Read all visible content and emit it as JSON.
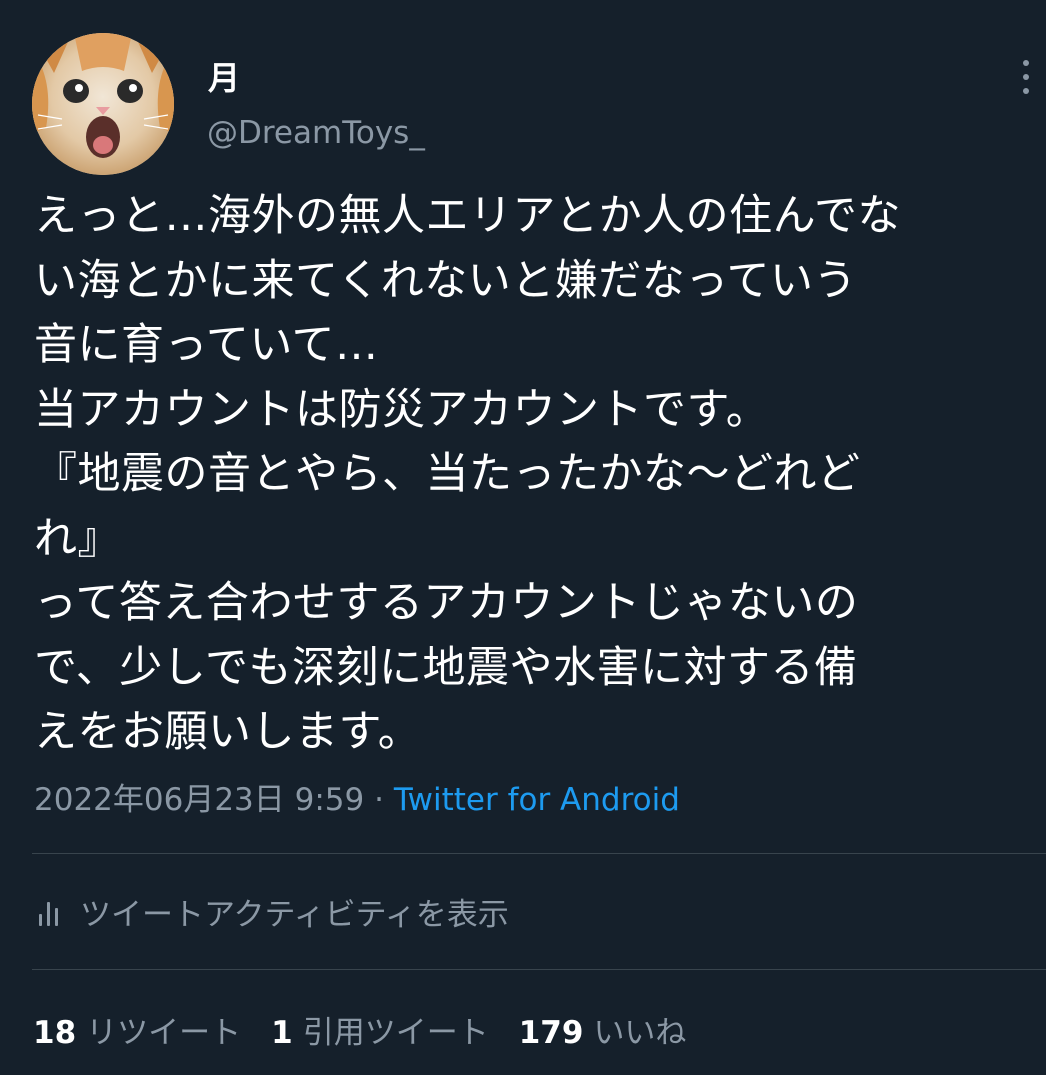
{
  "user": {
    "display_name": "月",
    "handle": "@DreamToys_",
    "avatar_icon": "cat-avatar-icon"
  },
  "tweet": {
    "lines": [
      "えっと…海外の無人エリアとか人の住んでな",
      "い海とかに来てくれないと嫌だなっていう",
      "音に育っていて…",
      "当アカウントは防災アカウントです。",
      "『地震の音とやら、当たったかな〜どれど",
      "れ』",
      "って答え合わせするアカウントじゃないの",
      "で、少しでも深刻に地震や水害に対する備",
      "えをお願いします。"
    ]
  },
  "meta": {
    "timestamp": "2022年06月23日 9:59",
    "separator": " · ",
    "source": "Twitter for Android"
  },
  "activity": {
    "label": "ツイートアクティビティを表示",
    "icon": "bar-chart-icon"
  },
  "stats": {
    "retweets_count": "18",
    "retweets_label": "リツイート",
    "quotes_count": "1",
    "quotes_label": "引用ツイート",
    "likes_count": "179",
    "likes_label": "いいね"
  },
  "colors": {
    "background": "#15202b",
    "text_primary": "#ffffff",
    "text_secondary": "#8b98a5",
    "link": "#1d9bf0",
    "divider": "#38444d"
  }
}
